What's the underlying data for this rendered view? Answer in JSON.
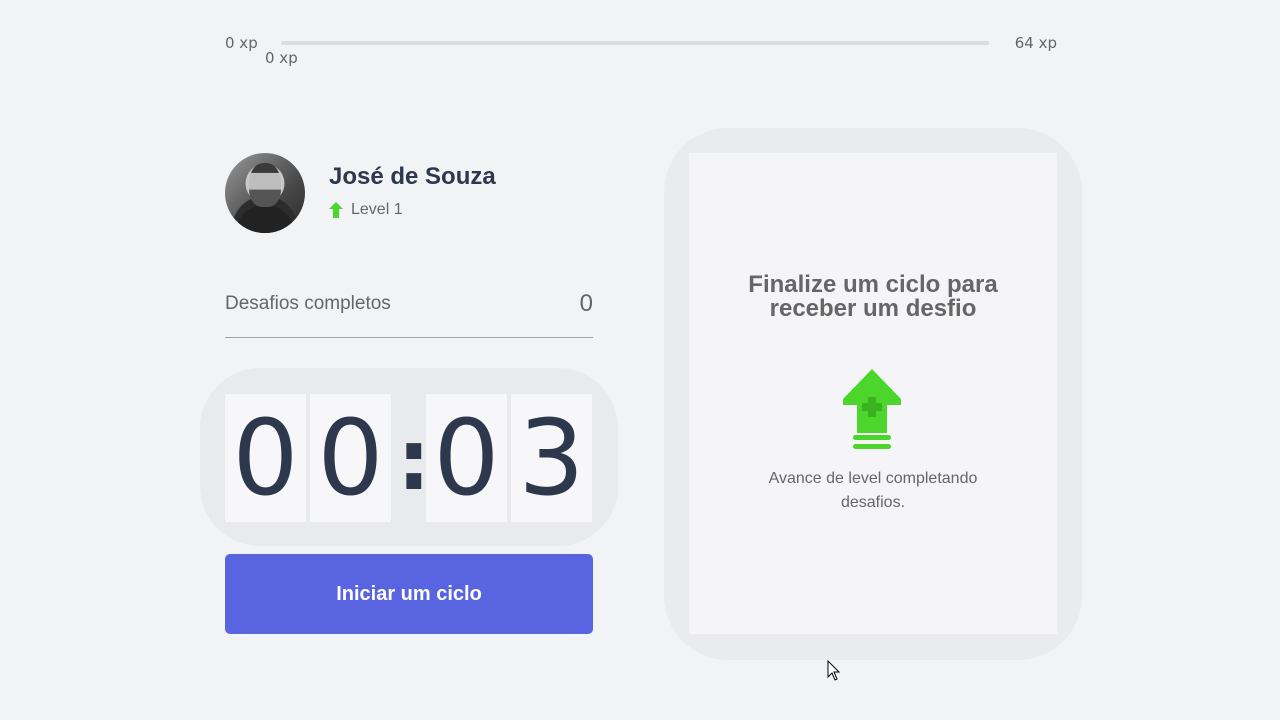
{
  "experience": {
    "min_label": "0 xp",
    "max_label": "64 xp",
    "current_label": "0 xp",
    "progress_percent": 0,
    "fill_color": "#4cd62b"
  },
  "profile": {
    "name": "José de Souza",
    "level_label": "Level 1",
    "level_icon": "level-up-arrow-icon"
  },
  "completed_challenges": {
    "label": "Desafios completos",
    "value": "0"
  },
  "countdown": {
    "minute_left": "0",
    "minute_right": "0",
    "separator": ":",
    "second_left": "0",
    "second_right": "3"
  },
  "start_button": {
    "label": "Iniciar um ciclo",
    "color": "#5965e0"
  },
  "challenge_box": {
    "title": "Finalize um ciclo para receber um desfio",
    "icon": "level-up-icon",
    "hint": "Avance de level completando desafios."
  },
  "colors": {
    "background": "#f2f3f5",
    "title_text": "#2e384d",
    "body_text": "#666666",
    "green": "#4cd62b"
  }
}
